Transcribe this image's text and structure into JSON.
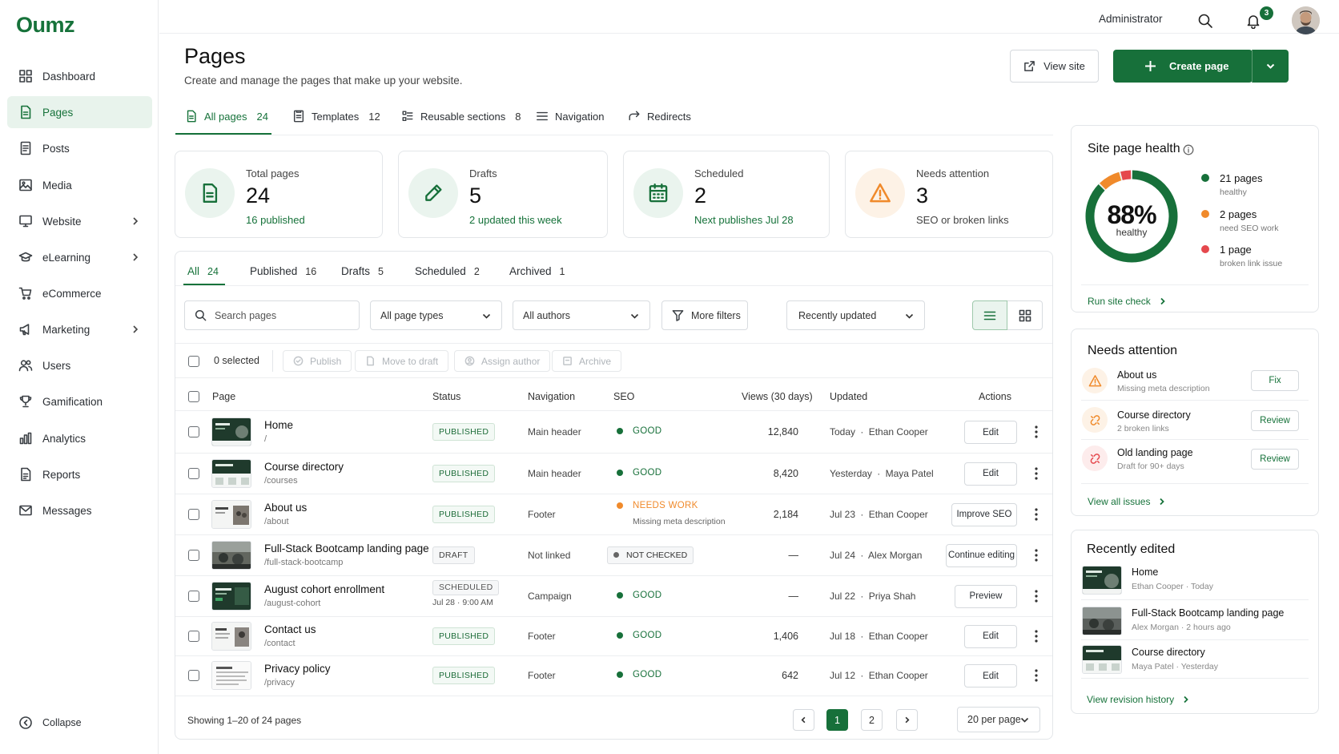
{
  "app": {
    "name": "Oumz"
  },
  "sidebar": {
    "items": [
      {
        "label": "Dashboard",
        "icon": "grid-icon"
      },
      {
        "label": "Pages",
        "icon": "file-icon"
      },
      {
        "label": "Posts",
        "icon": "document-icon"
      },
      {
        "label": "Media",
        "icon": "image-icon"
      },
      {
        "label": "Website",
        "icon": "monitor-icon"
      },
      {
        "label": "eLearning",
        "icon": "graduation-cap-icon"
      },
      {
        "label": "eCommerce",
        "icon": "cart-icon"
      },
      {
        "label": "Marketing",
        "icon": "megaphone-icon"
      },
      {
        "label": "Users",
        "icon": "users-icon"
      },
      {
        "label": "Gamification",
        "icon": "trophy-icon"
      },
      {
        "label": "Analytics",
        "icon": "bar-chart-icon"
      },
      {
        "label": "Reports",
        "icon": "report-icon"
      },
      {
        "label": "Messages",
        "icon": "mail-icon"
      }
    ],
    "collapse_label": "Collapse"
  },
  "topbar": {
    "user_label": "Administrator",
    "notification_count": "3"
  },
  "header": {
    "title": "Pages",
    "subtitle": "Create and manage the pages that make up your website.",
    "view_site_label": "View site",
    "create_page_label": "Create page"
  },
  "tabs": [
    {
      "label": "All pages",
      "count": "24"
    },
    {
      "label": "Templates",
      "count": "12"
    },
    {
      "label": "Reusable sections",
      "count": "8"
    },
    {
      "label": "Navigation",
      "count": ""
    },
    {
      "label": "Redirects",
      "count": ""
    }
  ],
  "stats": [
    {
      "label": "Total pages",
      "value": "24",
      "sub_num": "16",
      "sub_text": "published"
    },
    {
      "label": "Drafts",
      "value": "5",
      "sub_num": "2",
      "sub_text": "updated this week"
    },
    {
      "label": "Scheduled",
      "value": "2",
      "sub_num": "",
      "sub_text": "Next publishes Jul 28"
    },
    {
      "label": "Needs attention",
      "value": "3",
      "sub_num": "",
      "sub_text": "SEO or broken links"
    }
  ],
  "filter_tabs": [
    {
      "label": "All",
      "count": "24"
    },
    {
      "label": "Published",
      "count": "16"
    },
    {
      "label": "Drafts",
      "count": "5"
    },
    {
      "label": "Scheduled",
      "count": "2"
    },
    {
      "label": "Archived",
      "count": "1"
    }
  ],
  "filters": {
    "search_placeholder": "Search pages",
    "page_type": "All page types",
    "author": "All authors",
    "more_filters": "More filters",
    "sort": "Recently updated"
  },
  "bulk": {
    "selected": "0 selected",
    "publish": "Publish",
    "move_to_draft": "Move to draft",
    "assign_author": "Assign author",
    "archive": "Archive"
  },
  "table": {
    "columns": [
      "Page",
      "Status",
      "Navigation",
      "SEO",
      "Views (30 days)",
      "Updated",
      "Actions"
    ],
    "rows": [
      {
        "name": "Home",
        "slug": "/",
        "status": "PUBLISHED",
        "status_extra": "",
        "nav": "Main header",
        "seo": "GOOD",
        "seo_note": "",
        "views": "12,840",
        "updated_date": "Today",
        "updated_by": "Ethan Cooper",
        "action": "Edit"
      },
      {
        "name": "Course directory",
        "slug": "/courses",
        "status": "PUBLISHED",
        "status_extra": "",
        "nav": "Main header",
        "seo": "GOOD",
        "seo_note": "",
        "views": "8,420",
        "updated_date": "Yesterday",
        "updated_by": "Maya Patel",
        "action": "Edit"
      },
      {
        "name": "About us",
        "slug": "/about",
        "status": "PUBLISHED",
        "status_extra": "",
        "nav": "Footer",
        "seo": "NEEDS WORK",
        "seo_note": "Missing meta description",
        "views": "2,184",
        "updated_date": "Jul 23",
        "updated_by": "Ethan Cooper",
        "action": "Improve SEO"
      },
      {
        "name": "Full-Stack Bootcamp landing page",
        "slug": "/full-stack-bootcamp",
        "status": "DRAFT",
        "status_extra": "",
        "nav": "Not linked",
        "seo": "NOT CHECKED",
        "seo_note": "",
        "views": "—",
        "updated_date": "Jul 24",
        "updated_by": "Alex Morgan",
        "action": "Continue editing"
      },
      {
        "name": "August cohort enrollment",
        "slug": "/august-cohort",
        "status": "SCHEDULED",
        "status_extra": "Jul 28 · 9:00 AM",
        "nav": "Campaign",
        "seo": "GOOD",
        "seo_note": "",
        "views": "—",
        "updated_date": "Jul 22",
        "updated_by": "Priya Shah",
        "action": "Preview"
      },
      {
        "name": "Contact us",
        "slug": "/contact",
        "status": "PUBLISHED",
        "status_extra": "",
        "nav": "Footer",
        "seo": "GOOD",
        "seo_note": "",
        "views": "1,406",
        "updated_date": "Jul 18",
        "updated_by": "Ethan Cooper",
        "action": "Edit"
      },
      {
        "name": "Privacy policy",
        "slug": "/privacy",
        "status": "PUBLISHED",
        "status_extra": "",
        "nav": "Footer",
        "seo": "GOOD",
        "seo_note": "",
        "views": "642",
        "updated_date": "Jul 12",
        "updated_by": "Ethan Cooper",
        "action": "Edit"
      }
    ],
    "separator": "·"
  },
  "pagination": {
    "showing": "Showing 1–20 of 24 pages",
    "page1": "1",
    "page2": "2",
    "per_page": "20 per page"
  },
  "site_health": {
    "title": "Site page health",
    "percent": "88%",
    "percent_label": "healthy",
    "healthy_fraction": 0.875,
    "items": [
      {
        "count": "21",
        "unit": "pages",
        "desc": "healthy",
        "color": "#17703a"
      },
      {
        "count": "2",
        "unit": "pages",
        "desc": "need SEO work",
        "color": "#f08a2b"
      },
      {
        "count": "1",
        "unit": "page",
        "desc": "broken link issue",
        "color": "#e5484d"
      }
    ],
    "run_check": "Run site check"
  },
  "needs_attention": {
    "title": "Needs attention",
    "items": [
      {
        "title": "About us",
        "sub": "Missing meta description",
        "button": "Fix",
        "icon": "warning-icon"
      },
      {
        "title": "Course directory",
        "sub": "2 broken links",
        "button": "Review",
        "icon": "broken-link-icon"
      },
      {
        "title": "Old landing page",
        "sub": "Draft for 90+ days",
        "button": "Review",
        "icon": "broken-link-icon"
      }
    ],
    "view_all": "View all issues"
  },
  "recently_edited": {
    "title": "Recently edited",
    "items": [
      {
        "title": "Home",
        "author": "Ethan Cooper",
        "when": "Today"
      },
      {
        "title": "Full-Stack Bootcamp landing page",
        "author": "Alex Morgan",
        "when": "2 hours ago"
      },
      {
        "title": "Course directory",
        "author": "Maya Patel",
        "when": "Yesterday"
      }
    ],
    "view_history": "View revision history"
  },
  "colors": {
    "accent": "#17703a",
    "warning": "#f08a2b",
    "danger": "#e5484d"
  }
}
